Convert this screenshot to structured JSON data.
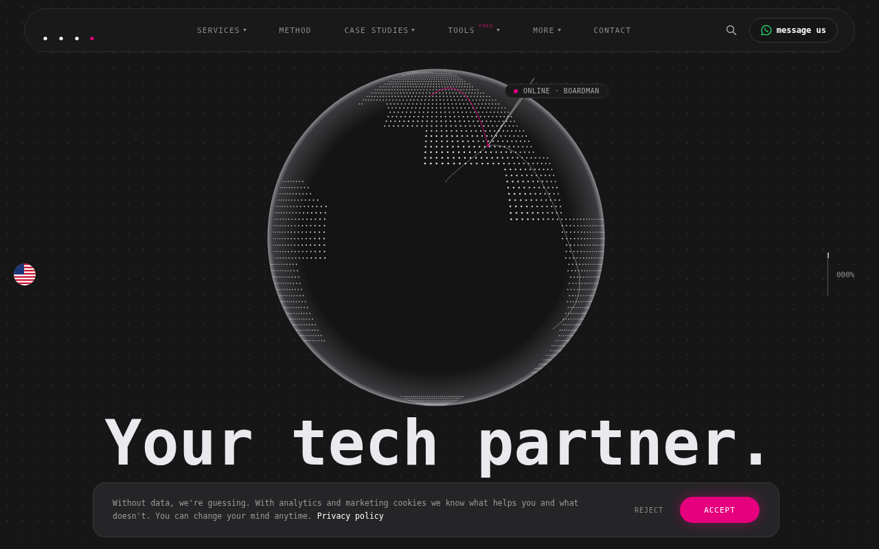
{
  "nav": {
    "items": [
      {
        "label": "SERVICES",
        "dropdown": true
      },
      {
        "label": "METHOD",
        "dropdown": false
      },
      {
        "label": "CASE STUDIES",
        "dropdown": true
      },
      {
        "label": "TOOLS",
        "dropdown": true,
        "badge": "FREE"
      },
      {
        "label": "MORE",
        "dropdown": true
      },
      {
        "label": "CONTACT",
        "dropdown": false
      }
    ],
    "cta": "message us"
  },
  "globe": {
    "status": "ONLINE · BOARDMAN"
  },
  "scroll_reading": "000%",
  "headline": "Your tech partner.",
  "cookie_banner": {
    "text": "Without data, we're guessing. With analytics and marketing cookies we know what helps you and what doesn't. You can change your mind anytime.",
    "link": "Privacy policy",
    "reject": "REJECT",
    "accept": "ACCEPT"
  }
}
